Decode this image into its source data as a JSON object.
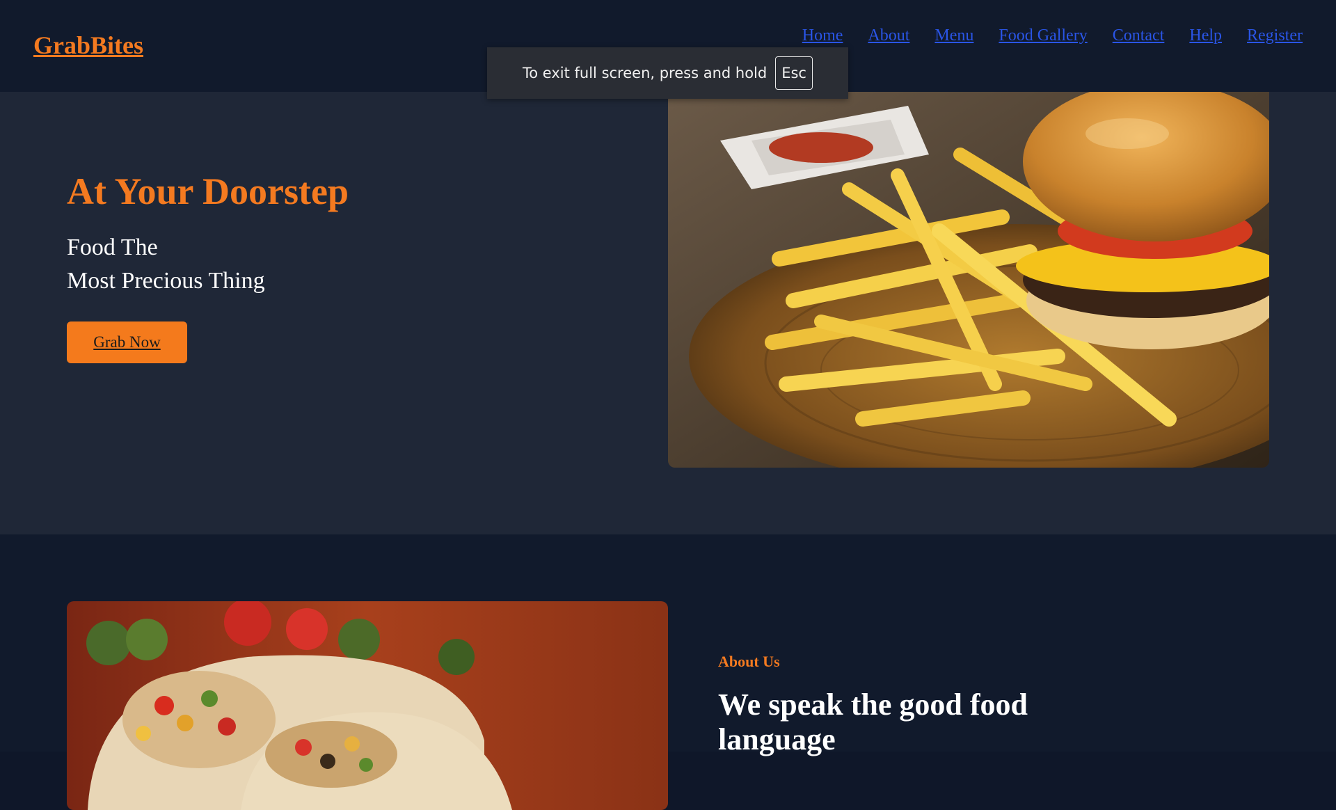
{
  "header": {
    "brand": "GrabBites",
    "nav": [
      {
        "label": "Home"
      },
      {
        "label": "About"
      },
      {
        "label": "Menu"
      },
      {
        "label": "Food Gallery"
      },
      {
        "label": "Contact"
      },
      {
        "label": "Help"
      },
      {
        "label": "Register"
      }
    ]
  },
  "hero": {
    "title": "At Your Doorstep",
    "subtitle_line1": "Food The",
    "subtitle_line2": "Most Precious Thing",
    "cta_label": "Grab Now",
    "image_icon": "burger-fries-photo"
  },
  "about": {
    "kicker": "About Us",
    "heading": "We speak the good food language",
    "image_icon": "burrito-wrap-photo"
  },
  "fullscreen_notice": {
    "text": "To exit full screen, press and hold",
    "key": "Esc"
  },
  "colors": {
    "accent": "#f47a20",
    "nav_link": "#2a55e6",
    "header_bg": "#111a2c",
    "hero_bg": "#1f2737"
  }
}
